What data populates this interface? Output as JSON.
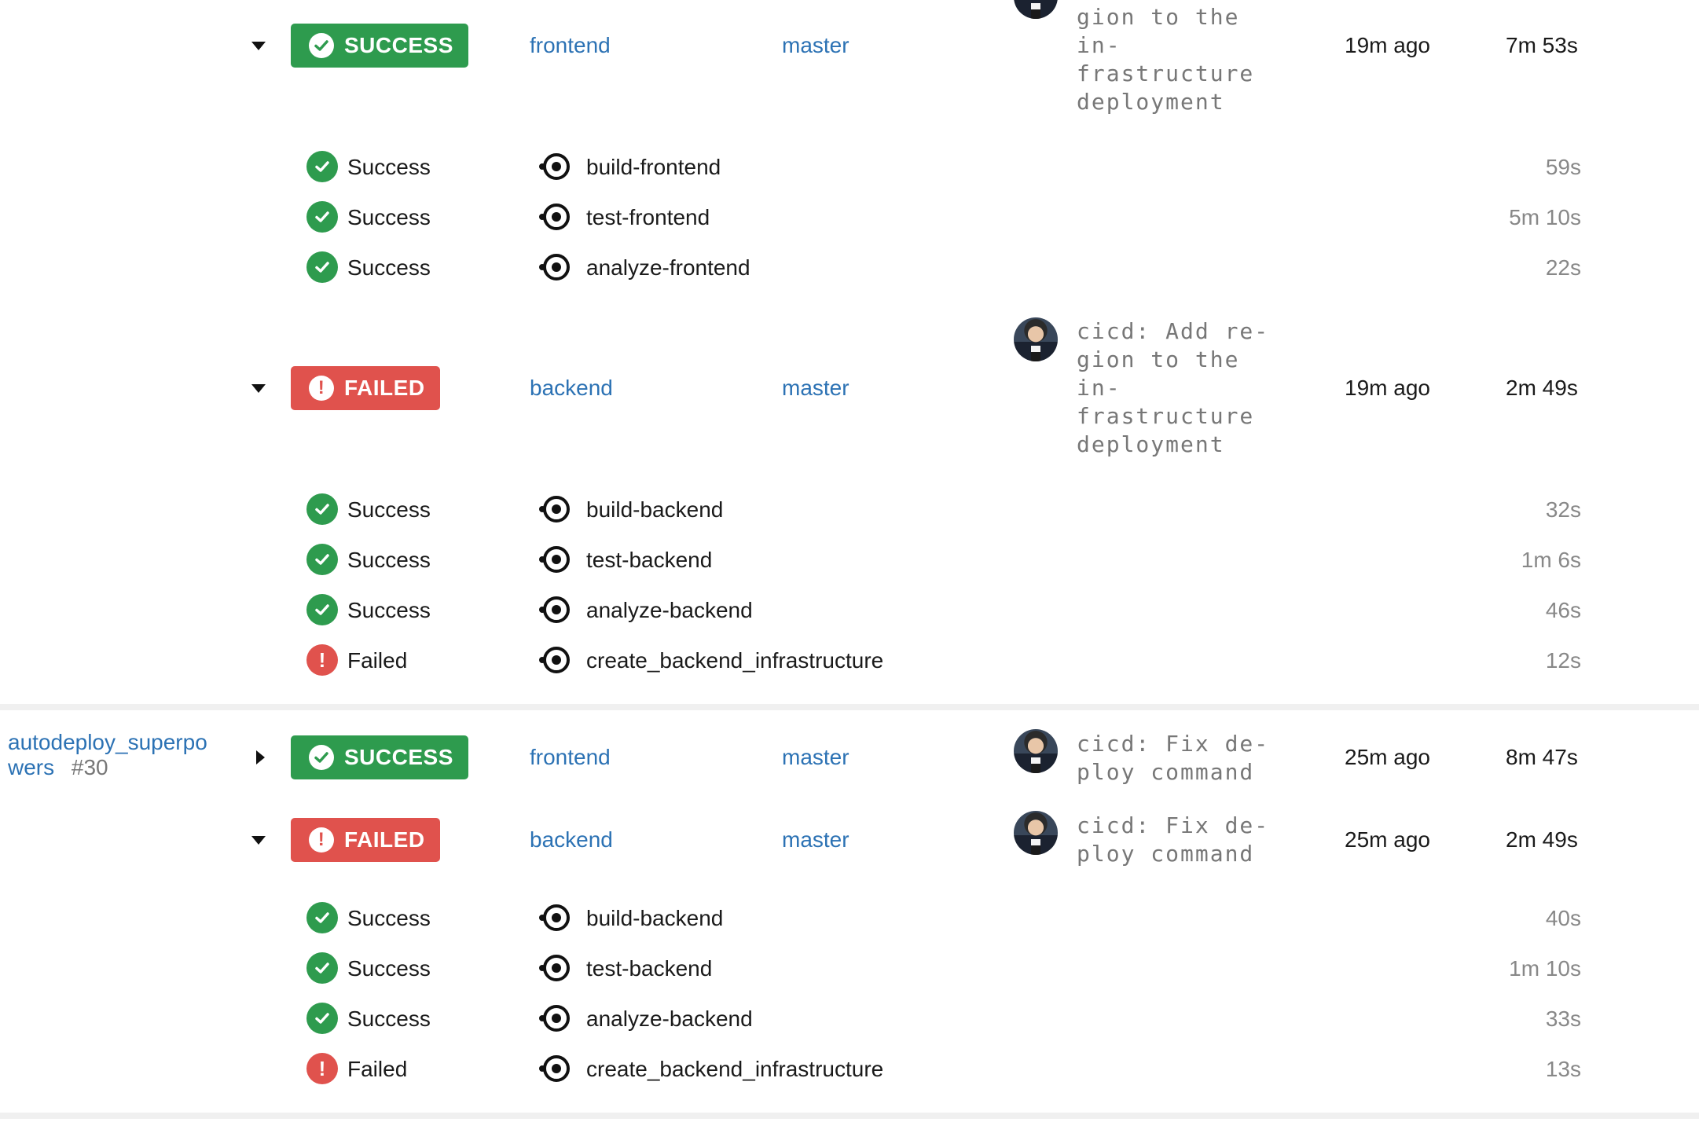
{
  "pipelines": [
    {
      "status": "SUCCESS",
      "project": "frontend",
      "branch": "master",
      "commit_lines": [
        "gion to the",
        "in-",
        "frastructure",
        "deployment"
      ],
      "time_ago": "19m ago",
      "duration": "7m 53s",
      "jobs": [
        {
          "status": "Success",
          "name": "build-frontend",
          "duration": "59s"
        },
        {
          "status": "Success",
          "name": "test-frontend",
          "duration": "5m 10s"
        },
        {
          "status": "Success",
          "name": "analyze-frontend",
          "duration": "22s"
        }
      ]
    },
    {
      "status": "FAILED",
      "project": "backend",
      "branch": "master",
      "commit_lines": [
        "cicd: Add re-",
        "gion to the",
        "in-",
        "frastructure",
        "deployment"
      ],
      "time_ago": "19m ago",
      "duration": "2m 49s",
      "jobs": [
        {
          "status": "Success",
          "name": "build-backend",
          "duration": "32s"
        },
        {
          "status": "Success",
          "name": "test-backend",
          "duration": "1m 6s"
        },
        {
          "status": "Success",
          "name": "analyze-backend",
          "duration": "46s"
        },
        {
          "status": "Failed",
          "name": "create_backend_infrastructure",
          "duration": "12s"
        }
      ]
    },
    {
      "workflow": {
        "name_line1": "autodeploy_superpo",
        "name_line2": "wers",
        "number": "#30"
      },
      "status": "SUCCESS",
      "project": "frontend",
      "branch": "master",
      "commit_lines": [
        "cicd: Fix de-",
        "ploy command"
      ],
      "time_ago": "25m ago",
      "duration": "8m 47s",
      "jobs": []
    },
    {
      "status": "FAILED",
      "project": "backend",
      "branch": "master",
      "commit_lines": [
        "cicd: Fix de-",
        "ploy command"
      ],
      "time_ago": "25m ago",
      "duration": "2m 49s",
      "jobs": [
        {
          "status": "Success",
          "name": "build-backend",
          "duration": "40s"
        },
        {
          "status": "Success",
          "name": "test-backend",
          "duration": "1m 10s"
        },
        {
          "status": "Success",
          "name": "analyze-backend",
          "duration": "33s"
        },
        {
          "status": "Failed",
          "name": "create_backend_infrastructure",
          "duration": "13s"
        }
      ]
    }
  ],
  "colors": {
    "success": "#2e9b4e",
    "failed": "#e0524d",
    "link": "#2c72b4"
  },
  "icons": {
    "success": "check-circle-icon",
    "failed": "exclamation-circle-icon",
    "job": "job-type-icon",
    "expand": "caret-icon"
  }
}
